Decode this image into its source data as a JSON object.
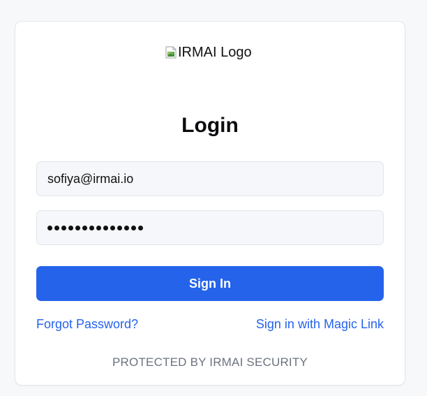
{
  "logo": {
    "alt_text": "IRMAI Logo"
  },
  "login": {
    "title": "Login",
    "email_value": "sofiya@irmai.io",
    "password_mask_length": 14,
    "signin_label": "Sign In",
    "forgot_password_label": "Forgot Password?",
    "magic_link_label": "Sign in with Magic Link"
  },
  "footer": {
    "text": "PROTECTED BY IRMAI SECURITY"
  },
  "colors": {
    "primary": "#2563eb",
    "field_bg": "#f5f7fa",
    "page_bg": "#f7f8fa",
    "footer_text": "#6b7280"
  }
}
